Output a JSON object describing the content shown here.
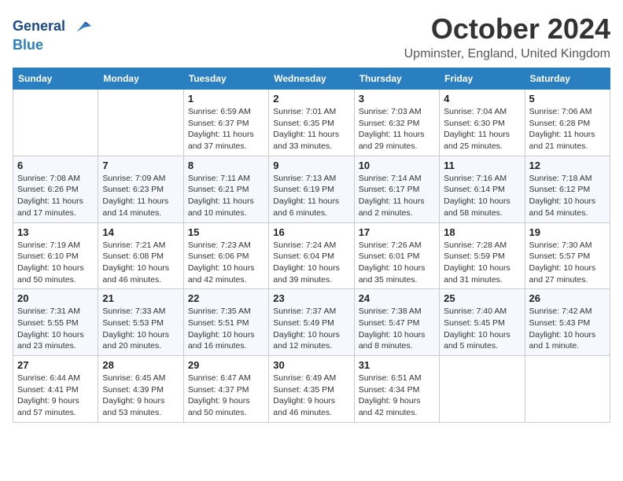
{
  "logo": {
    "line1": "General",
    "line2": "Blue"
  },
  "header": {
    "month": "October 2024",
    "location": "Upminster, England, United Kingdom"
  },
  "weekdays": [
    "Sunday",
    "Monday",
    "Tuesday",
    "Wednesday",
    "Thursday",
    "Friday",
    "Saturday"
  ],
  "weeks": [
    [
      null,
      null,
      {
        "day": "1",
        "sunrise": "6:59 AM",
        "sunset": "6:37 PM",
        "daylight": "Daylight: 11 hours and 37 minutes."
      },
      {
        "day": "2",
        "sunrise": "7:01 AM",
        "sunset": "6:35 PM",
        "daylight": "Daylight: 11 hours and 33 minutes."
      },
      {
        "day": "3",
        "sunrise": "7:03 AM",
        "sunset": "6:32 PM",
        "daylight": "Daylight: 11 hours and 29 minutes."
      },
      {
        "day": "4",
        "sunrise": "7:04 AM",
        "sunset": "6:30 PM",
        "daylight": "Daylight: 11 hours and 25 minutes."
      },
      {
        "day": "5",
        "sunrise": "7:06 AM",
        "sunset": "6:28 PM",
        "daylight": "Daylight: 11 hours and 21 minutes."
      }
    ],
    [
      {
        "day": "6",
        "sunrise": "7:08 AM",
        "sunset": "6:26 PM",
        "daylight": "Daylight: 11 hours and 17 minutes."
      },
      {
        "day": "7",
        "sunrise": "7:09 AM",
        "sunset": "6:23 PM",
        "daylight": "Daylight: 11 hours and 14 minutes."
      },
      {
        "day": "8",
        "sunrise": "7:11 AM",
        "sunset": "6:21 PM",
        "daylight": "Daylight: 11 hours and 10 minutes."
      },
      {
        "day": "9",
        "sunrise": "7:13 AM",
        "sunset": "6:19 PM",
        "daylight": "Daylight: 11 hours and 6 minutes."
      },
      {
        "day": "10",
        "sunrise": "7:14 AM",
        "sunset": "6:17 PM",
        "daylight": "Daylight: 11 hours and 2 minutes."
      },
      {
        "day": "11",
        "sunrise": "7:16 AM",
        "sunset": "6:14 PM",
        "daylight": "Daylight: 10 hours and 58 minutes."
      },
      {
        "day": "12",
        "sunrise": "7:18 AM",
        "sunset": "6:12 PM",
        "daylight": "Daylight: 10 hours and 54 minutes."
      }
    ],
    [
      {
        "day": "13",
        "sunrise": "7:19 AM",
        "sunset": "6:10 PM",
        "daylight": "Daylight: 10 hours and 50 minutes."
      },
      {
        "day": "14",
        "sunrise": "7:21 AM",
        "sunset": "6:08 PM",
        "daylight": "Daylight: 10 hours and 46 minutes."
      },
      {
        "day": "15",
        "sunrise": "7:23 AM",
        "sunset": "6:06 PM",
        "daylight": "Daylight: 10 hours and 42 minutes."
      },
      {
        "day": "16",
        "sunrise": "7:24 AM",
        "sunset": "6:04 PM",
        "daylight": "Daylight: 10 hours and 39 minutes."
      },
      {
        "day": "17",
        "sunrise": "7:26 AM",
        "sunset": "6:01 PM",
        "daylight": "Daylight: 10 hours and 35 minutes."
      },
      {
        "day": "18",
        "sunrise": "7:28 AM",
        "sunset": "5:59 PM",
        "daylight": "Daylight: 10 hours and 31 minutes."
      },
      {
        "day": "19",
        "sunrise": "7:30 AM",
        "sunset": "5:57 PM",
        "daylight": "Daylight: 10 hours and 27 minutes."
      }
    ],
    [
      {
        "day": "20",
        "sunrise": "7:31 AM",
        "sunset": "5:55 PM",
        "daylight": "Daylight: 10 hours and 23 minutes."
      },
      {
        "day": "21",
        "sunrise": "7:33 AM",
        "sunset": "5:53 PM",
        "daylight": "Daylight: 10 hours and 20 minutes."
      },
      {
        "day": "22",
        "sunrise": "7:35 AM",
        "sunset": "5:51 PM",
        "daylight": "Daylight: 10 hours and 16 minutes."
      },
      {
        "day": "23",
        "sunrise": "7:37 AM",
        "sunset": "5:49 PM",
        "daylight": "Daylight: 10 hours and 12 minutes."
      },
      {
        "day": "24",
        "sunrise": "7:38 AM",
        "sunset": "5:47 PM",
        "daylight": "Daylight: 10 hours and 8 minutes."
      },
      {
        "day": "25",
        "sunrise": "7:40 AM",
        "sunset": "5:45 PM",
        "daylight": "Daylight: 10 hours and 5 minutes."
      },
      {
        "day": "26",
        "sunrise": "7:42 AM",
        "sunset": "5:43 PM",
        "daylight": "Daylight: 10 hours and 1 minute."
      }
    ],
    [
      {
        "day": "27",
        "sunrise": "6:44 AM",
        "sunset": "4:41 PM",
        "daylight": "Daylight: 9 hours and 57 minutes."
      },
      {
        "day": "28",
        "sunrise": "6:45 AM",
        "sunset": "4:39 PM",
        "daylight": "Daylight: 9 hours and 53 minutes."
      },
      {
        "day": "29",
        "sunrise": "6:47 AM",
        "sunset": "4:37 PM",
        "daylight": "Daylight: 9 hours and 50 minutes."
      },
      {
        "day": "30",
        "sunrise": "6:49 AM",
        "sunset": "4:35 PM",
        "daylight": "Daylight: 9 hours and 46 minutes."
      },
      {
        "day": "31",
        "sunrise": "6:51 AM",
        "sunset": "4:34 PM",
        "daylight": "Daylight: 9 hours and 42 minutes."
      },
      null,
      null
    ]
  ]
}
